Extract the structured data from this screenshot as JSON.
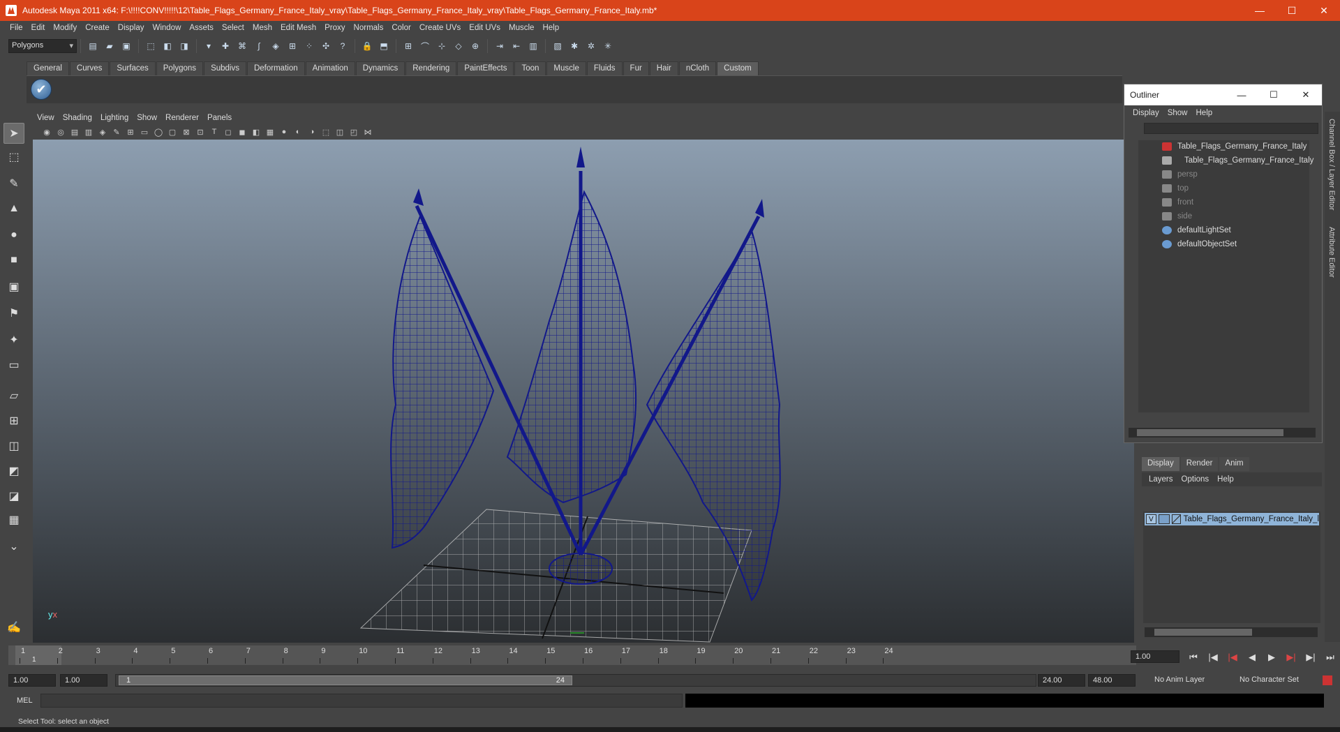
{
  "window": {
    "title": "Autodesk Maya 2011 x64: F:\\!!!!CONV!!!!!\\12\\Table_Flags_Germany_France_Italy_vray\\Table_Flags_Germany_France_Italy_vray\\Table_Flags_Germany_France_Italy.mb*",
    "minimize": "—",
    "maximize": "☐",
    "close": "✕"
  },
  "menubar": [
    "File",
    "Edit",
    "Modify",
    "Create",
    "Display",
    "Window",
    "Assets",
    "Select",
    "Mesh",
    "Edit Mesh",
    "Proxy",
    "Normals",
    "Color",
    "Create UVs",
    "Edit UVs",
    "Muscle",
    "Help"
  ],
  "statusline": {
    "mode": "Polygons"
  },
  "shelf": {
    "tabs": [
      "General",
      "Curves",
      "Surfaces",
      "Polygons",
      "Subdivs",
      "Deformation",
      "Animation",
      "Dynamics",
      "Rendering",
      "PaintEffects",
      "Toon",
      "Muscle",
      "Fluids",
      "Fur",
      "Hair",
      "nCloth",
      "Custom"
    ],
    "active_tab": "Custom",
    "button_glyph": "✔"
  },
  "viewport": {
    "menu": [
      "View",
      "Shading",
      "Lighting",
      "Show",
      "Renderer",
      "Panels"
    ],
    "axis": {
      "y": "y",
      "x": "x"
    }
  },
  "outliner": {
    "title": "Outliner",
    "menu": [
      "Display",
      "Show",
      "Help"
    ],
    "items": [
      {
        "label": "Table_Flags_Germany_France_Italy",
        "dim": false
      },
      {
        "label": "Table_Flags_Germany_France_Italy",
        "dim": false
      },
      {
        "label": "persp",
        "dim": true
      },
      {
        "label": "top",
        "dim": true
      },
      {
        "label": "front",
        "dim": true
      },
      {
        "label": "side",
        "dim": true
      },
      {
        "label": "defaultLightSet",
        "dim": false
      },
      {
        "label": "defaultObjectSet",
        "dim": false
      }
    ]
  },
  "layers": {
    "tabs": [
      "Display",
      "Render",
      "Anim"
    ],
    "active_tab": "Display",
    "menu": [
      "Layers",
      "Options",
      "Help"
    ],
    "layer_name": "Table_Flags_Germany_France_Italy_l",
    "visible_flag": "V"
  },
  "right_tabs": {
    "channel_box": "Channel Box / Layer Editor",
    "attribute": "Attribute Editor"
  },
  "timeline": {
    "ticks": [
      1,
      2,
      3,
      4,
      5,
      6,
      7,
      8,
      9,
      10,
      11,
      12,
      13,
      14,
      15,
      16,
      17,
      18,
      19,
      20,
      21,
      22,
      23,
      24
    ],
    "current_frame": "1",
    "current_frame_field": "1.00",
    "playback": [
      "⏮",
      "|◀",
      "|◀",
      "◀",
      "▶",
      "▶|",
      "▶|",
      "⏭"
    ]
  },
  "range": {
    "start": "1.00",
    "playback_start": "1.00",
    "slider_start": "1",
    "slider_end": "24",
    "playback_end": "24.00",
    "end": "48.00",
    "anim_layer": "No Anim Layer",
    "char_set": "No Character Set"
  },
  "commandline": {
    "label": "MEL"
  },
  "helpline": {
    "text": "Select Tool: select an object"
  },
  "colors": {
    "titlebar": "#d9441a",
    "wire": "#12188a",
    "grid": "#cfcfcf"
  }
}
